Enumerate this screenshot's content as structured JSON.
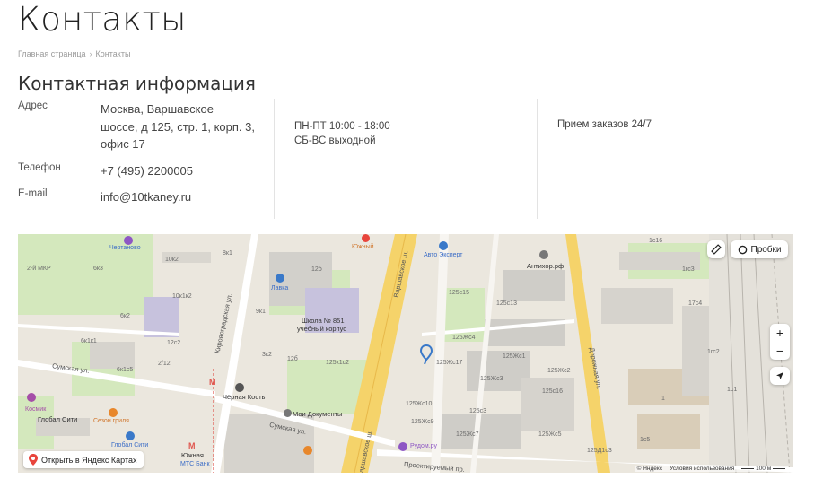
{
  "page": {
    "title": "Контакты"
  },
  "breadcrumb": {
    "home": "Главная страница",
    "separator": "›",
    "current": "Контакты"
  },
  "contact": {
    "section_title": "Контактная информация",
    "address_label": "Адрес",
    "address_lines": [
      "Москва, Варшавское",
      "шоссе, д 125, стр. 1, корп. 3,",
      "офис 17"
    ],
    "phone_label": "Телефон",
    "phone_value": "+7 (495) 2200005",
    "email_label": "E-mail",
    "email_value": "info@10tkaney.ru",
    "hours_weekdays": "ПН-ПТ 10:00 - 18:00",
    "hours_weekend": "СБ-ВС выходной",
    "orders": "Прием заказов 24/7"
  },
  "map": {
    "traffic_label": "Пробки",
    "zoom_in": "+",
    "zoom_out": "−",
    "open_yandex": "Открыть в Яндекс Картах",
    "footer_brand": "© Яндекс",
    "footer_terms": "Условия использования",
    "footer_scale": "100 м",
    "labels": {
      "chertanovo": "Чертаново",
      "mkr": "2-й МКР",
      "k6_3": "6к3",
      "k10_2": "10к2",
      "k8": "8к1",
      "lavka": "Лавка",
      "k12b": "12б",
      "yuzhny": "Южный",
      "avto": "Авто Эксперт",
      "antihor": "Антихор.рф",
      "k1c16": "1с16",
      "k1c3": "1гс3",
      "k10k1": "10к1к2",
      "k6k2": "6к2",
      "k9k1": "9к1",
      "school": "Школа № 851",
      "school2": "учебный корпус",
      "k125_15": "125с15",
      "k125_13": "125с13",
      "kirovo": "Кировоградская ул.",
      "varsh": "Варшавское ш.",
      "varsh2": "Варшавское ш.",
      "doroz": "Дорожная ул.",
      "k6k1": "6к1к1",
      "k12c2": "12с2",
      "k6c5": "6к1с5",
      "sumsk": "Сумская ул.",
      "sumsk2": "Сумская ул.",
      "k2_12": "2/12",
      "k3c2": "3к2",
      "k12c1": "12б",
      "k125k1": "125к1с2",
      "k125k6": "125Жс4",
      "k125k17": "125Жс17",
      "k125k3": "125Жс3",
      "k125c1": "125Жс1",
      "k125c2": "125Жс2",
      "k125c16": "125с16",
      "kosmik": "Космик",
      "global": "Глобал Сити",
      "chernaya": "Чёрная Кость",
      "mydocs": "Мои Документы",
      "season": "Сезон гриля",
      "global2": "Глобал Сити",
      "yuzhnaya": "Южная",
      "mts": "МТС Банк",
      "rudom": "Рудом.ру",
      "proektir": "Проектируемый пр.",
      "k125k10": "125Жс10",
      "k125k9": "125Жс9",
      "k125k5": "125Жс5",
      "k125k7": "125Жс7",
      "k125s3": "125с3",
      "k125c21": "125Д1с3",
      "k1": "1",
      "k1c5": "1с5",
      "k17": "17с4",
      "k1c2": "1гс2",
      "k1c1": "1с1"
    }
  },
  "colors": {
    "map_bg": "#ebe7de",
    "road_yellow": "#f5d36a",
    "road_white": "#ffffff",
    "green": "#cfe7b3",
    "building": "#d9d7d2",
    "blue_pin": "#3a79c9",
    "pin_red": "#e8453c"
  }
}
